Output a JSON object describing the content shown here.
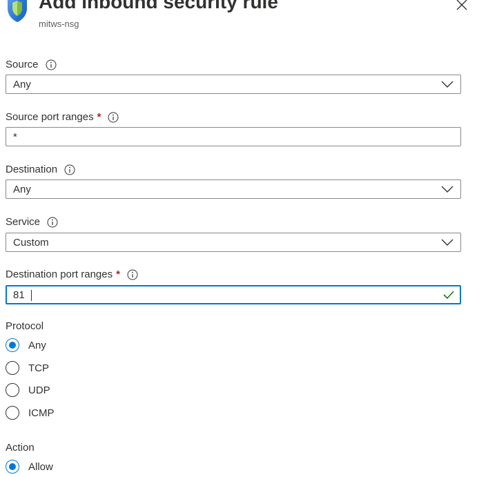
{
  "header": {
    "title": "Add inbound security rule",
    "subtitle": "mitws-nsg"
  },
  "form": {
    "source": {
      "label": "Source",
      "value": "Any"
    },
    "source_ports": {
      "label": "Source port ranges",
      "required_mark": "*",
      "value": "*"
    },
    "destination": {
      "label": "Destination",
      "value": "Any"
    },
    "service": {
      "label": "Service",
      "value": "Custom"
    },
    "destination_ports": {
      "label": "Destination port ranges",
      "required_mark": "*",
      "value": "81"
    },
    "protocol": {
      "label": "Protocol",
      "options": [
        "Any",
        "TCP",
        "UDP",
        "ICMP"
      ],
      "selected": "Any"
    },
    "action": {
      "label": "Action",
      "options": [
        "Allow"
      ],
      "selected": "Allow"
    }
  },
  "colors": {
    "accent": "#0078d4",
    "required": "#a4262c",
    "valid": "#107c10",
    "border": "#8a8886"
  },
  "icons": {
    "header": "shield-icon",
    "close": "close-icon",
    "info": "info-icon",
    "dropdown": "chevron-down-icon",
    "valid": "checkmark-icon"
  }
}
